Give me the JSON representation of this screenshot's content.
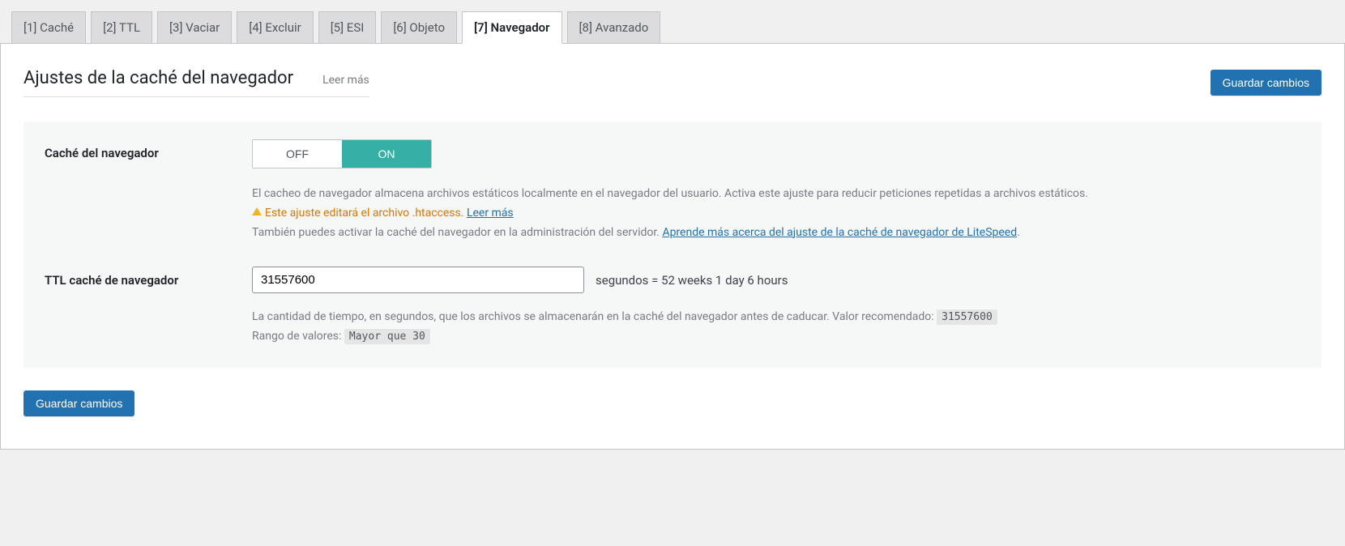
{
  "tabs": [
    {
      "label": "[1] Caché"
    },
    {
      "label": "[2] TTL"
    },
    {
      "label": "[3] Vaciar"
    },
    {
      "label": "[4] Excluir"
    },
    {
      "label": "[5] ESI"
    },
    {
      "label": "[6] Objeto"
    },
    {
      "label": "[7] Navegador"
    },
    {
      "label": "[8] Avanzado"
    }
  ],
  "active_tab_index": 6,
  "page": {
    "title": "Ajustes de la caché del navegador",
    "read_more": "Leer más",
    "save_button": "Guardar cambios"
  },
  "browser_cache": {
    "label": "Caché del navegador",
    "off": "OFF",
    "on": "ON",
    "desc1": "El cacheo de navegador almacena archivos estáticos localmente en el navegador del usuario. Activa este ajuste para reducir peticiones repetidas a archivos estáticos.",
    "warn_text": "Este ajuste editará el archivo .htaccess.",
    "warn_link": "Leer más",
    "desc2_pre": "También puedes activar la caché del navegador en la administración del servidor. ",
    "desc2_link": "Aprende más acerca del ajuste de la caché de navegador de LiteSpeed",
    "desc2_post": "."
  },
  "ttl": {
    "label": "TTL caché de navegador",
    "value": "31557600",
    "suffix": "segundos = 52 weeks 1 day 6 hours",
    "desc_pre": "La cantidad de tiempo, en segundos, que los archivos se almacenarán en la caché del navegador antes de caducar. Valor recomendado: ",
    "recommended": "31557600",
    "range_pre": "Rango de valores: ",
    "range_val": "Mayor que 30"
  }
}
